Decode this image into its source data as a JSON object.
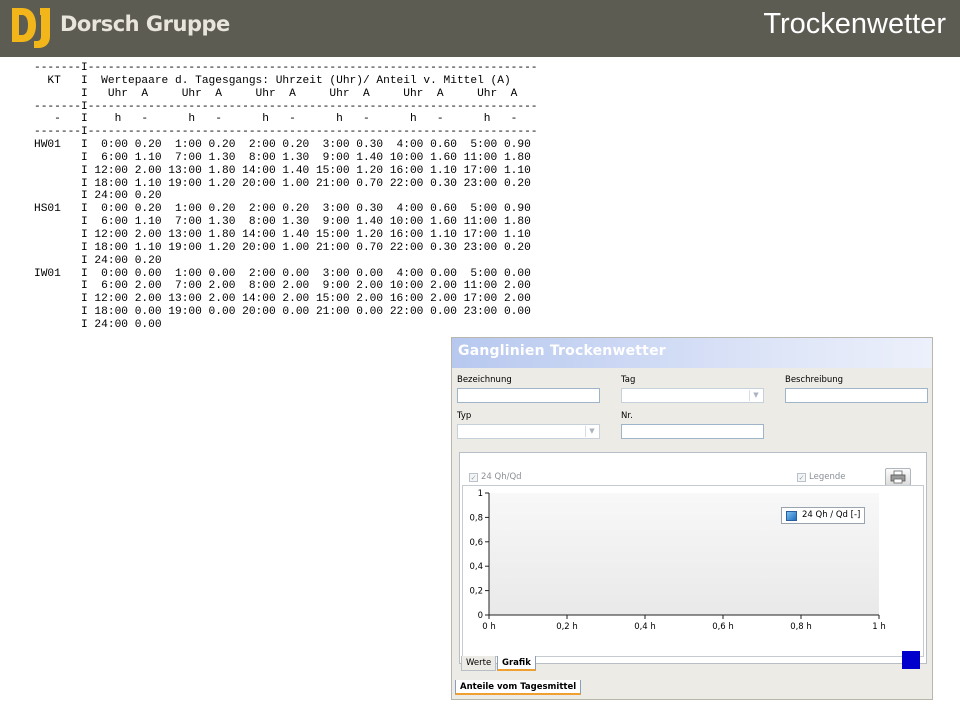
{
  "header": {
    "brand": "Dorsch Gruppe",
    "slide_title": "Trockenwetter",
    "colors": {
      "bar": "#5d5c53",
      "logo_yellow": "#f2b51a"
    }
  },
  "table_lines": [
    "-------I-------------------------------------------------------------------",
    "  KT   I  Wertepaare d. Tagesgangs: Uhrzeit (Uhr)/ Anteil v. Mittel (A)",
    "       I   Uhr  A     Uhr  A     Uhr  A     Uhr  A     Uhr  A     Uhr  A",
    "-------I-------------------------------------------------------------------",
    "   -   I    h   -      h   -      h   -      h   -      h   -      h   -",
    "-------I-------------------------------------------------------------------",
    "HW01   I  0:00 0.20  1:00 0.20  2:00 0.20  3:00 0.30  4:00 0.60  5:00 0.90",
    "       I  6:00 1.10  7:00 1.30  8:00 1.30  9:00 1.40 10:00 1.60 11:00 1.80",
    "       I 12:00 2.00 13:00 1.80 14:00 1.40 15:00 1.20 16:00 1.10 17:00 1.10",
    "       I 18:00 1.10 19:00 1.20 20:00 1.00 21:00 0.70 22:00 0.30 23:00 0.20",
    "       I 24:00 0.20",
    "HS01   I  0:00 0.20  1:00 0.20  2:00 0.20  3:00 0.30  4:00 0.60  5:00 0.90",
    "       I  6:00 1.10  7:00 1.30  8:00 1.30  9:00 1.40 10:00 1.60 11:00 1.80",
    "       I 12:00 2.00 13:00 1.80 14:00 1.40 15:00 1.20 16:00 1.10 17:00 1.10",
    "       I 18:00 1.10 19:00 1.20 20:00 1.00 21:00 0.70 22:00 0.30 23:00 0.20",
    "       I 24:00 0.20",
    "IW01   I  0:00 0.00  1:00 0.00  2:00 0.00  3:00 0.00  4:00 0.00  5:00 0.00",
    "       I  6:00 2.00  7:00 2.00  8:00 2.00  9:00 2.00 10:00 2.00 11:00 2.00",
    "       I 12:00 2.00 13:00 2.00 14:00 2.00 15:00 2.00 16:00 2.00 17:00 2.00",
    "       I 18:00 0.00 19:00 0.00 20:00 0.00 21:00 0.00 22:00 0.00 23:00 0.00",
    "       I 24:00 0.00"
  ],
  "dialog": {
    "title": "Ganglinien Trockenwetter",
    "fields": {
      "bezeichnung_label": "Bezeichnung",
      "bezeichnung_value": "",
      "tag_label": "Tag",
      "tag_value": "",
      "beschreibung_label": "Beschreibung",
      "beschreibung_value": "",
      "typ_label": "Typ",
      "typ_value": "",
      "nr_label": "Nr.",
      "nr_value": ""
    },
    "options": {
      "qh_label": "24 Qh/Qd",
      "qh_checked": true,
      "legende_label": "Legende",
      "legende_checked": true
    },
    "tabs": [
      "Werte",
      "Grafik"
    ],
    "active_tab": "Grafik",
    "bottom_tab": "Anteile vom Tagesmittel",
    "colors": {
      "header_start": "#b7c8ef",
      "series": "#1f6fc0",
      "blue_square": "#0000cc"
    }
  },
  "chart_data": {
    "type": "line",
    "x_ticks": [
      "0 h",
      "0,2 h",
      "0,4 h",
      "0,6 h",
      "0,8 h",
      "1 h"
    ],
    "y_ticks": [
      "0",
      "0,2",
      "0,4",
      "0,6",
      "0,8",
      "1"
    ],
    "xlim": [
      0,
      1
    ],
    "ylim": [
      0,
      1
    ],
    "series": [
      {
        "name": "24 Qh / Qd [-]",
        "x": [],
        "y": []
      }
    ],
    "legend": "top-right",
    "grid": false
  }
}
